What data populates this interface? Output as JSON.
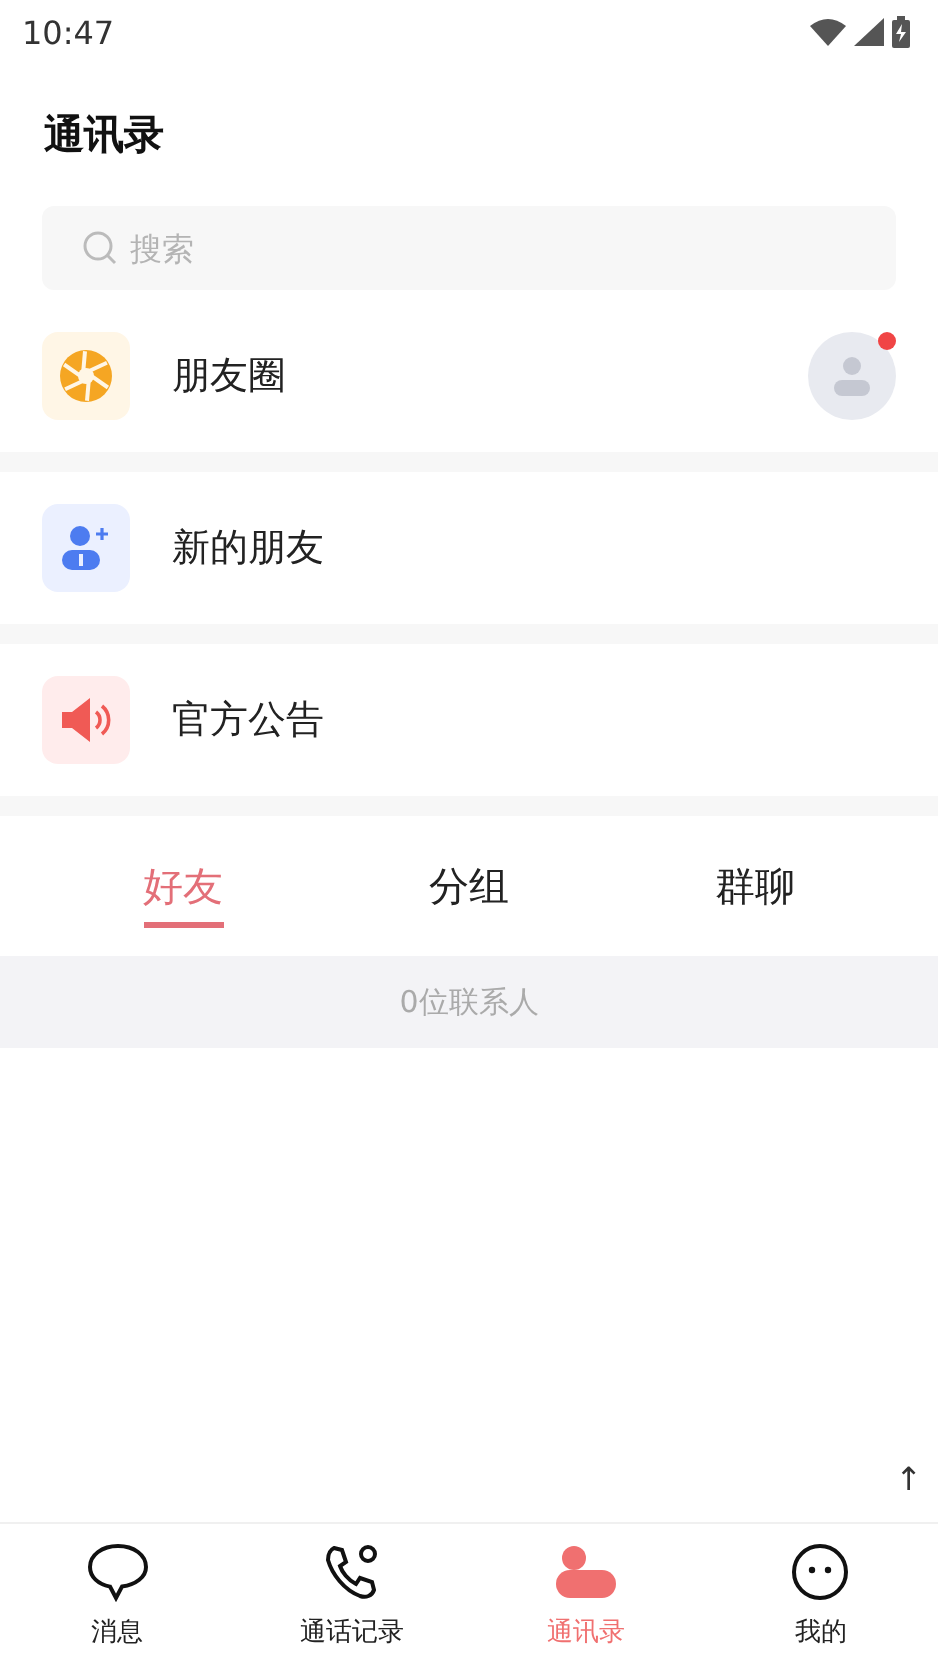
{
  "status_bar": {
    "time": "10:47"
  },
  "header": {
    "title": "通讯录"
  },
  "search": {
    "placeholder": "搜索"
  },
  "entries": [
    {
      "kind": "moments",
      "label": "朋友圈",
      "badge": true
    },
    {
      "kind": "new_friends",
      "label": "新的朋友"
    },
    {
      "kind": "announcements",
      "label": "官方公告"
    }
  ],
  "tabs": [
    {
      "label": "好友",
      "selected": true
    },
    {
      "label": "分组",
      "selected": false
    },
    {
      "label": "群聊",
      "selected": false
    }
  ],
  "contact_count": "0位联系人",
  "scroll_top": "↑",
  "bottom_nav": [
    {
      "kind": "messages",
      "label": "消息",
      "selected": false
    },
    {
      "kind": "calls",
      "label": "通话记录",
      "selected": false
    },
    {
      "kind": "contacts",
      "label": "通讯录",
      "selected": true
    },
    {
      "kind": "me",
      "label": "我的",
      "selected": false
    }
  ]
}
